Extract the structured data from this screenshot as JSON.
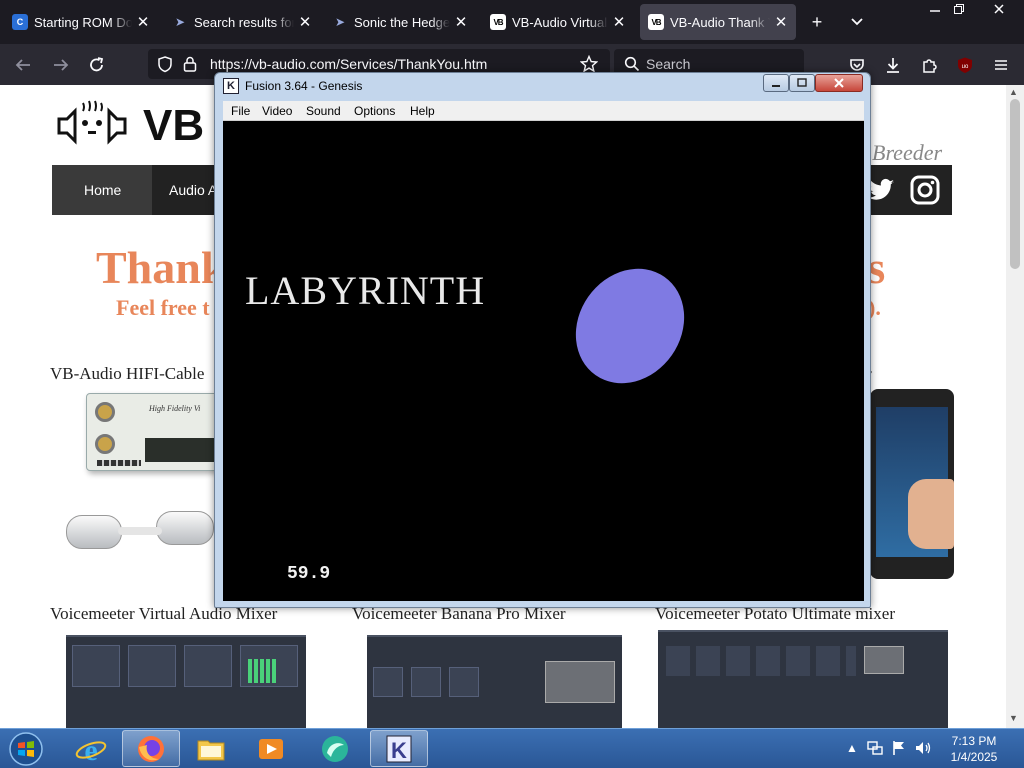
{
  "browser": {
    "tabs": [
      {
        "title": "Starting ROM Download",
        "icon": "c-logo-icon",
        "active": false
      },
      {
        "title": "Search results for 'Sonic'",
        "icon": "sonic-icon",
        "active": false
      },
      {
        "title": "Sonic the Hedgehog",
        "icon": "sonic-icon",
        "active": false
      },
      {
        "title": "VB-Audio Virtual Apps",
        "icon": "vb-logo-icon",
        "active": false
      },
      {
        "title": "VB-Audio Thank You",
        "icon": "vb-logo-icon",
        "active": true
      }
    ],
    "fav_vb": "VB",
    "new_tab": "+",
    "tab_list": "⌄",
    "url": "https://vb-audio.com/Services/ThankYou.htm",
    "search_placeholder": "Search"
  },
  "page": {
    "logo_text": "VB",
    "breeder_text": "Breeder",
    "nav": [
      "Home",
      "Audio A"
    ],
    "thanks_left": "Thank",
    "thanks_right": "ts",
    "feel_left": "Feel free t",
    "feel_right": ").",
    "products": [
      "VB-Audio HIFI-Cable",
      "r",
      "Voicemeeter Virtual Audio Mixer",
      "Voicemeeter Banana Pro Mixer",
      "Voicemeeter Potato Ultimate mixer"
    ],
    "hifi_label": "High Fidelity Vi"
  },
  "fusion": {
    "title": "Fusion 3.64 - Genesis",
    "menu": [
      "File",
      "Video",
      "Sound",
      "Options",
      "Help"
    ],
    "game_title": "LABYRINTH",
    "fps": "59.9",
    "ellipse_color": "#7f7ae3"
  },
  "taskbar": {
    "clock_time": "7:13 PM",
    "clock_date": "1/4/2025",
    "apps": [
      "windows-start",
      "internet-explorer",
      "firefox",
      "file-explorer",
      "media-player",
      "app-globe",
      "fusion-k"
    ]
  },
  "colors": {
    "accent_orange": "#e8865a",
    "firefox_dark": "#1c1b22",
    "taskbar_blue": "#2a5796"
  }
}
